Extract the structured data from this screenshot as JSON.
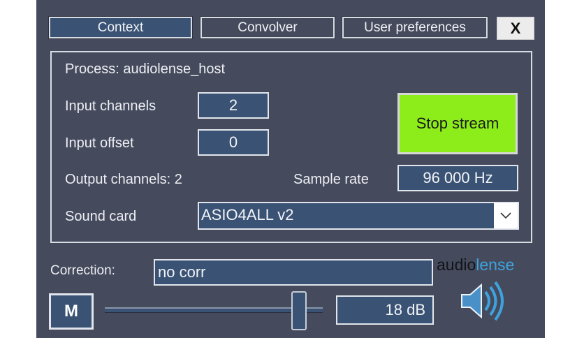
{
  "tabs": [
    {
      "label": "Context",
      "active": true
    },
    {
      "label": "Convolver",
      "active": false
    },
    {
      "label": "User preferences",
      "active": false
    }
  ],
  "close_label": "X",
  "process": {
    "label": "Process:",
    "name": "audiolense_host"
  },
  "input_channels": {
    "label": "Input channels",
    "value": "2"
  },
  "input_offset": {
    "label": "Input offset",
    "value": "0"
  },
  "output_channels": {
    "label": "Output channels:",
    "value": "2"
  },
  "stream_button": {
    "label": "Stop stream",
    "color": "#8ded1a"
  },
  "sample_rate": {
    "label": "Sample rate",
    "value": "96 000 Hz"
  },
  "sound_card": {
    "label": "Sound card",
    "value": "ASIO4ALL v2"
  },
  "correction": {
    "label": "Correction:",
    "value": "no corr"
  },
  "mute_label": "M",
  "gain": {
    "value": "18 dB",
    "slider_level": 0.92
  },
  "brand": {
    "part1": "audio",
    "part2": "lense",
    "accent": "#3ea3dd"
  },
  "colors": {
    "background": "#454a5d",
    "field": "#3a5274"
  }
}
